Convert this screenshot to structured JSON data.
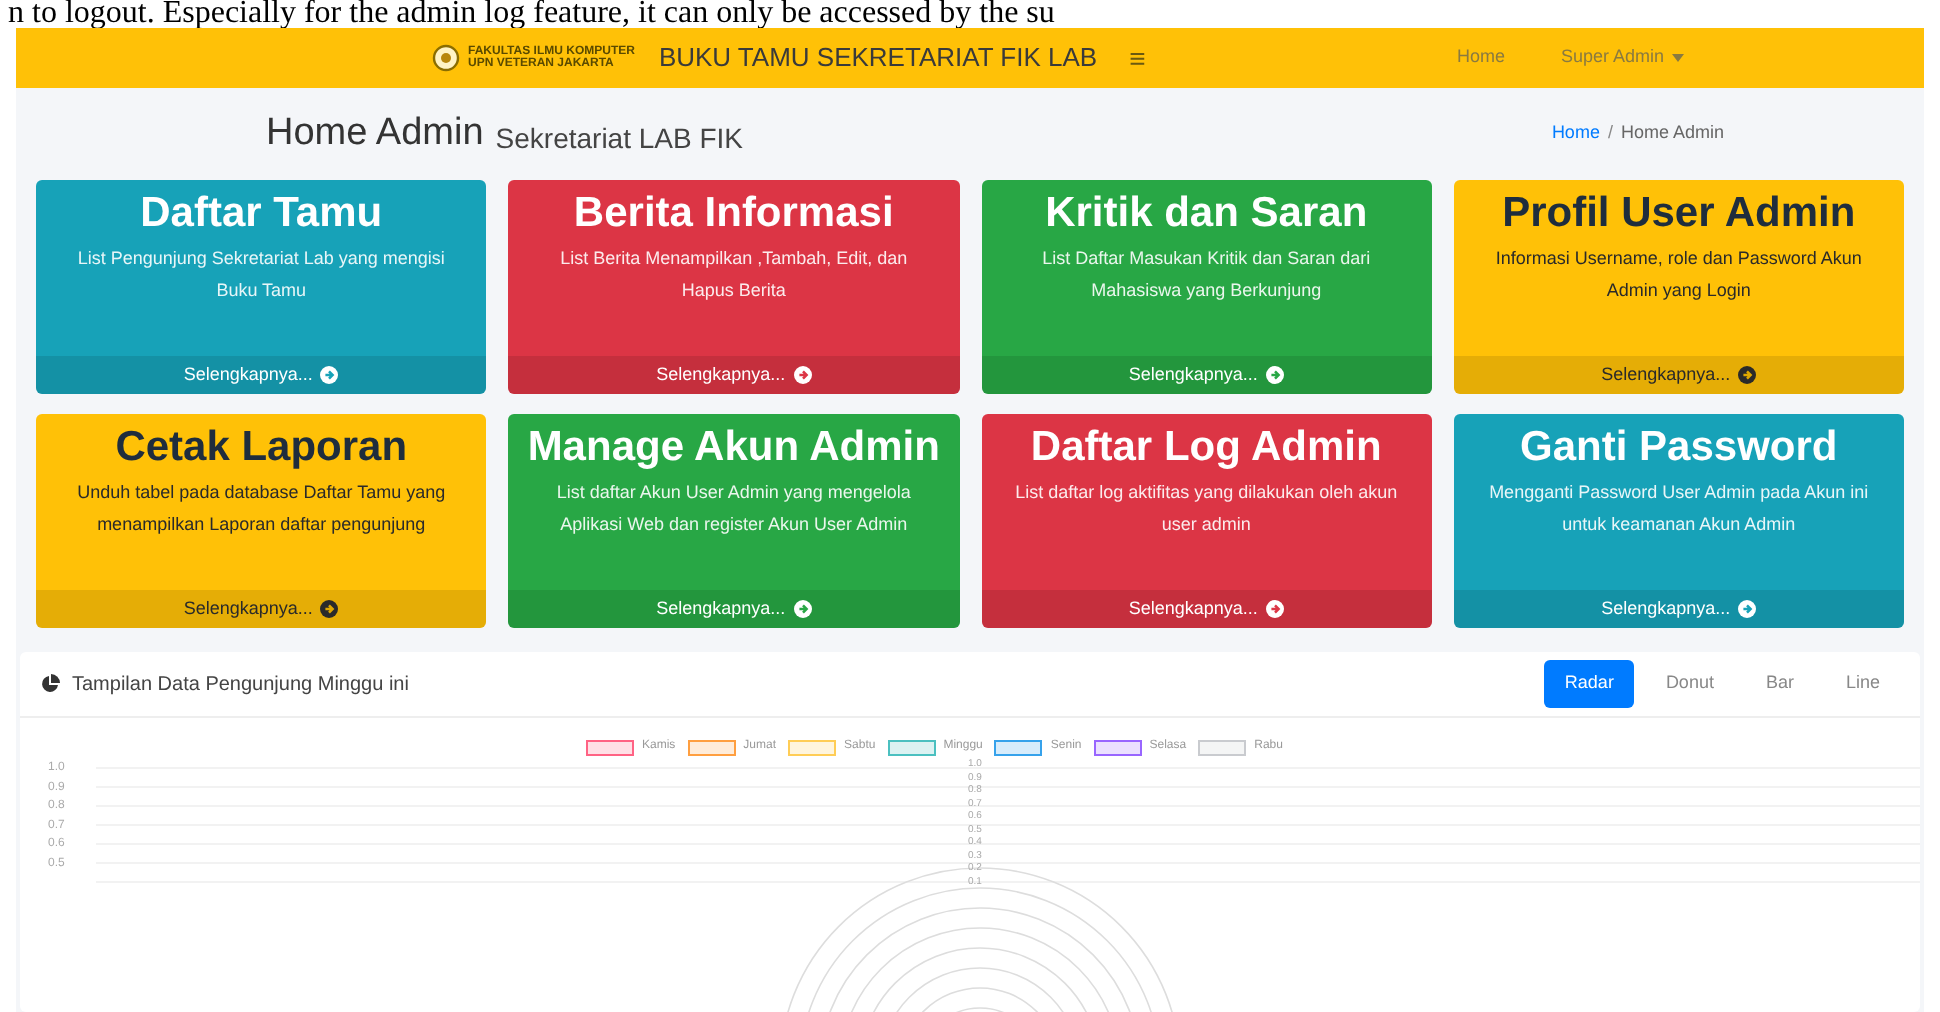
{
  "document_text": "n to logout. Especially for the admin log feature, it can only be accessed by the su",
  "navbar": {
    "logo_lines": [
      "FAKULTAS ILMU KOMPUTER",
      "UPN VETERAN JAKARTA"
    ],
    "brand": "BUKU TAMU SEKRETARIAT FIK LAB",
    "menu_icon": "≡",
    "links": [
      {
        "label": "Home",
        "dropdown": false
      },
      {
        "label": "Super Admin",
        "dropdown": true
      }
    ]
  },
  "header": {
    "title": "Home Admin",
    "subtitle": "Sekretariat LAB FIK",
    "breadcrumb": [
      {
        "label": "Home",
        "kind": "link"
      },
      {
        "label": "/",
        "kind": "separator"
      },
      {
        "label": "Home Admin",
        "kind": "current"
      }
    ]
  },
  "cards": [
    {
      "title": "Daftar Tamu",
      "text": "List Pengunjung Sekretariat Lab yang mengisi Buku Tamu",
      "link": "Selengkapnya...",
      "color": "#17a2b8",
      "kind": "dark"
    },
    {
      "title": "Berita Informasi",
      "text": "List Berita Menampilkan ,Tambah, Edit, dan Hapus Berita",
      "link": "Selengkapnya...",
      "color": "#dc3545",
      "kind": "dark"
    },
    {
      "title": "Kritik dan Saran",
      "text": "List Daftar Masukan Kritik dan Saran dari Mahasiswa yang Berkunjung",
      "link": "Selengkapnya...",
      "color": "#28a745",
      "kind": "dark"
    },
    {
      "title": "Profil User Admin",
      "text": "Informasi Username, role dan Password Akun Admin yang Login",
      "link": "Selengkapnya...",
      "color": "#ffc107",
      "kind": "light"
    },
    {
      "title": "Cetak Laporan",
      "text": "Unduh tabel pada database Daftar Tamu yang menampilkan Laporan daftar pengunjung",
      "link": "Selengkapnya...",
      "color": "#ffc107",
      "kind": "light"
    },
    {
      "title": "Manage Akun Admin",
      "text": "List daftar Akun User Admin yang mengelola Aplikasi Web dan register Akun User Admin",
      "link": "Selengkapnya...",
      "color": "#28a745",
      "kind": "dark"
    },
    {
      "title": "Daftar Log Admin",
      "text": "List daftar log aktifitas yang dilakukan oleh akun user admin",
      "link": "Selengkapnya...",
      "color": "#dc3545",
      "kind": "dark"
    },
    {
      "title": "Ganti Password",
      "text": "Mengganti Password User Admin pada Akun ini untuk keamanan Akun Admin",
      "link": "Selengkapnya...",
      "color": "#17a2b8",
      "kind": "dark"
    }
  ],
  "chart_panel": {
    "title": "Tampilan Data Pengunjung Minggu ini",
    "tabs": [
      {
        "label": "Radar",
        "selected": true
      },
      {
        "label": "Donut",
        "selected": false
      },
      {
        "label": "Bar",
        "selected": false
      },
      {
        "label": "Line",
        "selected": false
      }
    ],
    "legend": [
      {
        "label": "Kamis",
        "color": "#ff6384"
      },
      {
        "label": "Jumat",
        "color": "#ff9f40"
      },
      {
        "label": "Sabtu",
        "color": "#ffcd56"
      },
      {
        "label": "Minggu",
        "color": "#4bc0c0"
      },
      {
        "label": "Senin",
        "color": "#36a2eb"
      },
      {
        "label": "Selasa",
        "color": "#9966ff"
      },
      {
        "label": "Rabu",
        "color": "#c9cbcf"
      }
    ],
    "axis_ticks": [
      "1.0",
      "0.9",
      "0.8",
      "0.7",
      "0.6",
      "0.5"
    ],
    "radar_ticks": [
      "1.0",
      "0.9",
      "0.8",
      "0.7",
      "0.6",
      "0.5",
      "0.4",
      "0.3",
      "0.2",
      "0.1"
    ]
  }
}
